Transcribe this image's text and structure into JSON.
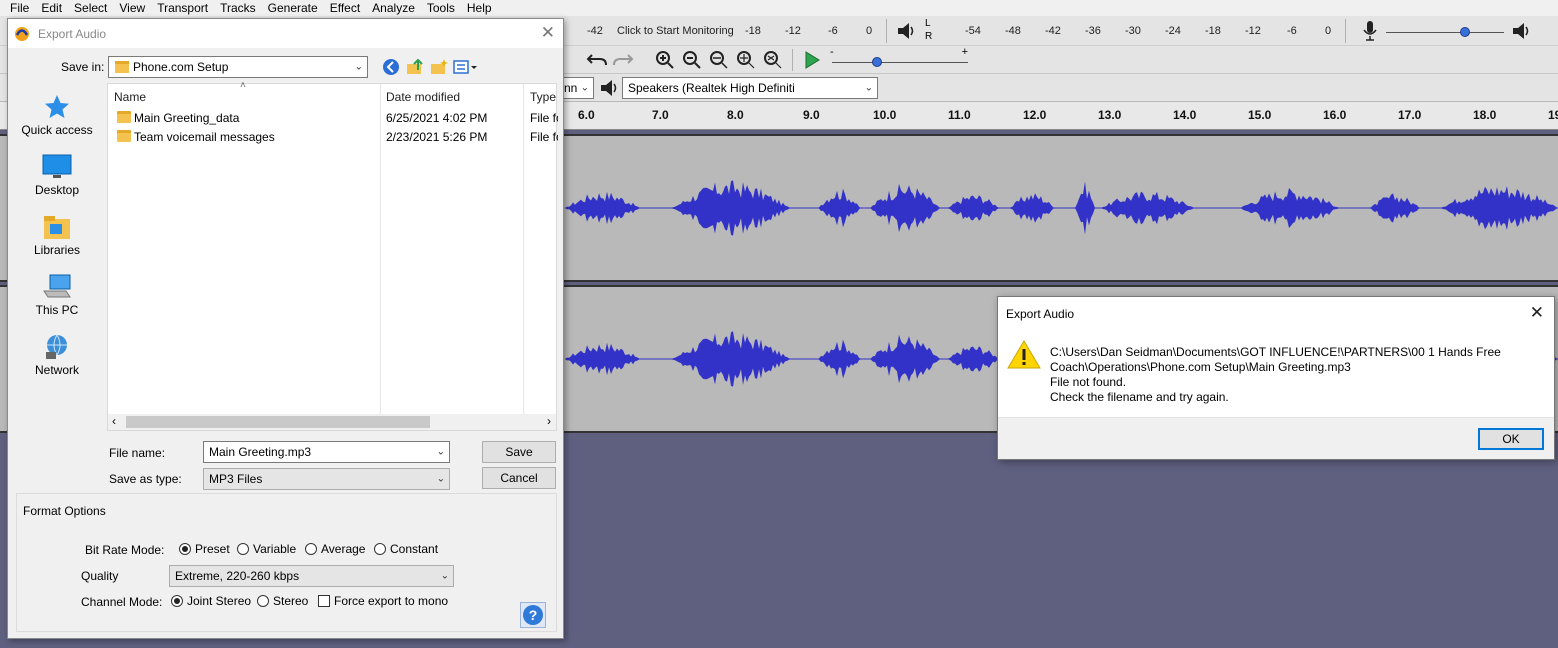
{
  "menubar": {
    "items": [
      "File",
      "Edit",
      "Select",
      "View",
      "Transport",
      "Tracks",
      "Generate",
      "Effect",
      "Analyze",
      "Tools",
      "Help"
    ]
  },
  "meters": {
    "record_ticks": [
      "-42",
      "-18",
      "-12",
      "-6",
      "0"
    ],
    "monitor_prompt": "Click to Start Monitoring",
    "playback_ticks": [
      "-54",
      "-48",
      "-42",
      "-36",
      "-30",
      "-24",
      "-18",
      "-12",
      "-6",
      "0"
    ],
    "lr_left": "L",
    "lr_right": "R"
  },
  "device_toolbar": {
    "partial_host": "nn",
    "output_device": "Speakers (Realtek High Definiti"
  },
  "ruler": {
    "ticks": [
      "6.0",
      "7.0",
      "8.0",
      "9.0",
      "10.0",
      "11.0",
      "12.0",
      "13.0",
      "14.0",
      "15.0",
      "16.0",
      "17.0",
      "18.0",
      "19"
    ]
  },
  "colors": {
    "waveform": "#3232c8",
    "track_bg": "#b9b9b9",
    "background": "#5f6080",
    "accent": "#0078d7"
  },
  "export_dialog": {
    "title": "Export Audio",
    "save_in_label": "Save in:",
    "save_in_value": "Phone.com Setup",
    "places": [
      "Quick access",
      "Desktop",
      "Libraries",
      "This PC",
      "Network"
    ],
    "columns": [
      "Name",
      "Date modified",
      "Type"
    ],
    "files": [
      {
        "name": "Main Greeting_data",
        "date": "6/25/2021 4:02 PM",
        "type": "File fo"
      },
      {
        "name": "Team voicemail messages",
        "date": "2/23/2021 5:26 PM",
        "type": "File fo"
      }
    ],
    "file_name_label": "File name:",
    "file_name_value": "Main Greeting.mp3",
    "save_as_type_label": "Save as type:",
    "save_as_type_value": "MP3 Files",
    "save_button": "Save",
    "cancel_button": "Cancel",
    "format_options": {
      "title": "Format Options",
      "bit_rate_label": "Bit Rate Mode:",
      "bit_rate_options": [
        "Preset",
        "Variable",
        "Average",
        "Constant"
      ],
      "bit_rate_selected": "Preset",
      "quality_label": "Quality",
      "quality_value": "Extreme, 220-260 kbps",
      "channel_label": "Channel Mode:",
      "channel_options": [
        "Joint Stereo",
        "Stereo"
      ],
      "channel_selected": "Joint Stereo",
      "force_mono_label": "Force export to mono",
      "force_mono_checked": false,
      "help_button": "?"
    }
  },
  "error_dialog": {
    "title": "Export Audio",
    "line1": "C:\\Users\\Dan Seidman\\Documents\\GOT INFLUENCE!\\PARTNERS\\00 1 Hands Free",
    "line2": "Coach\\Operations\\Phone.com Setup\\Main Greeting.mp3",
    "line3": "File not found.",
    "line4": "Check the filename and try again.",
    "ok_button": "OK"
  }
}
